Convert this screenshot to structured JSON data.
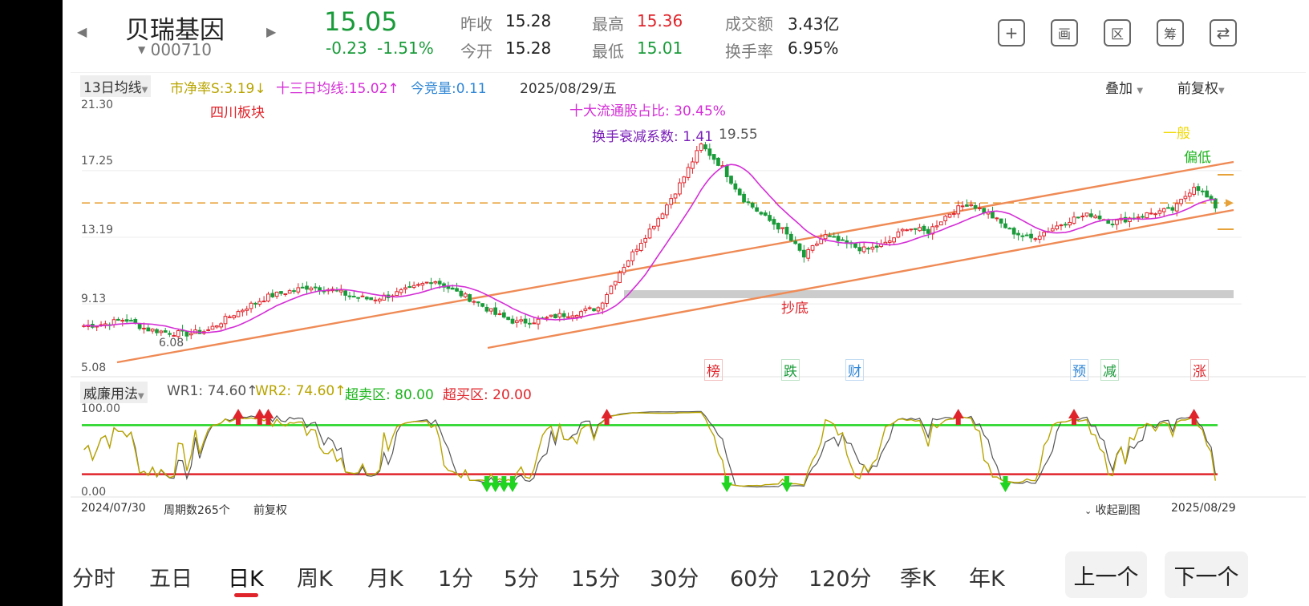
{
  "stock": {
    "name": "贝瑞基因",
    "code": "000710"
  },
  "quote": {
    "price": "15.05",
    "change": "-0.23",
    "change_pct": "-1.51%",
    "prev_close_label": "昨收",
    "prev_close": "15.28",
    "open_label": "今开",
    "open": "15.28",
    "high_label": "最高",
    "high": "15.36",
    "low_label": "最低",
    "low": "15.01",
    "turnover_amt_label": "成交额",
    "turnover_amt": "3.43亿",
    "turnover_rate_label": "换手率",
    "turnover_rate": "6.95%"
  },
  "header_icons": [
    "add-icon",
    "drawing-board-icon",
    "region-icon",
    "filter-icon",
    "screen-rotate-icon"
  ],
  "header_icon_glyphs": [
    "+",
    "画",
    "区",
    "筹",
    "⇄"
  ],
  "main_chart": {
    "indicator_select": "13日均线",
    "legend": [
      {
        "text": "市净率S:3.19↓",
        "color": "#b8a400"
      },
      {
        "text": "十三日均线:15.02↑",
        "color": "#d42ed6"
      },
      {
        "text": "今竞量:0.11",
        "color": "#2f86d6"
      }
    ],
    "date": "2025/08/29/五",
    "overlay_label": "叠加",
    "adjust_label": "前复权",
    "y_ticks": [
      "21.30",
      "17.25",
      "13.19",
      "9.13",
      "5.08"
    ],
    "annotations": {
      "sector": "四川板块",
      "float_holders": "十大流通股占比:  30.45%",
      "turnover_decay": "换手衰减系数: 1.41",
      "peak_price": "19.55",
      "low_price": "6.08",
      "bottom_label": "抄底",
      "grade1": "一般",
      "grade2": "偏低"
    },
    "event_tags": [
      {
        "text": "榜",
        "color": "#e0242b"
      },
      {
        "text": "跌",
        "color": "#1a9b3a"
      },
      {
        "text": "财",
        "color": "#2f86d6"
      },
      {
        "text": "预",
        "color": "#2f86d6"
      },
      {
        "text": "减",
        "color": "#1a9b3a"
      },
      {
        "text": "涨",
        "color": "#e0242b"
      }
    ]
  },
  "sub_chart": {
    "indicator_select": "威廉用法",
    "legend": [
      {
        "text": "WR1: 74.60↑",
        "color": "#555555"
      },
      {
        "text": "WR2: 74.60↑",
        "color": "#b8a400"
      },
      {
        "text": "超卖区: 80.00",
        "color": "#1ab41a"
      },
      {
        "text": "超买区: 20.00",
        "color": "#e0242b"
      }
    ],
    "y_top": "100.00",
    "y_bottom": "0.00",
    "start_date": "2024/07/30",
    "period_count": "周期数265个",
    "adjust_label": "前复权",
    "collapse_label": "收起副图",
    "end_date": "2025/08/29"
  },
  "tabs": [
    "分时",
    "五日",
    "日K",
    "周K",
    "月K",
    "1分",
    "5分",
    "15分",
    "30分",
    "60分",
    "120分",
    "季K",
    "年K"
  ],
  "active_tab": "日K",
  "nav": {
    "prev": "上一个",
    "next": "下一个"
  },
  "chart_data": {
    "type": "candlestick",
    "start_date": "2024/07/30",
    "end_date": "2025/08/29",
    "periods": 265,
    "ylim": [
      5.08,
      21.3
    ],
    "y_ticks": [
      5.08,
      9.13,
      13.19,
      17.25,
      21.3
    ],
    "approx_close_path": [
      7.8,
      7.9,
      8.2,
      7.6,
      7.4,
      7.3,
      7.5,
      8.3,
      9.0,
      9.6,
      9.9,
      10.2,
      10.0,
      9.6,
      9.4,
      9.7,
      10.1,
      10.6,
      9.9,
      9.3,
      8.5,
      8.0,
      8.1,
      8.4,
      8.6,
      8.9,
      11.0,
      12.8,
      14.5,
      16.5,
      18.8,
      17.5,
      15.6,
      14.5,
      13.6,
      12.0,
      13.3,
      12.8,
      12.4,
      12.8,
      13.8,
      13.5,
      14.6,
      15.3,
      14.6,
      13.6,
      13.1,
      13.7,
      14.3,
      14.6,
      14.1,
      14.4,
      14.7,
      14.9,
      16.4,
      15.05
    ],
    "ma13_last": 15.02,
    "high_annotation": 19.55,
    "low_annotation": 6.08,
    "dashed_level": 15.28,
    "wr_series": {
      "WR1_last": 74.6,
      "WR2_last": 74.6,
      "oversold": 80.0,
      "overbought": 20.0,
      "range": [
        0,
        100
      ]
    }
  }
}
